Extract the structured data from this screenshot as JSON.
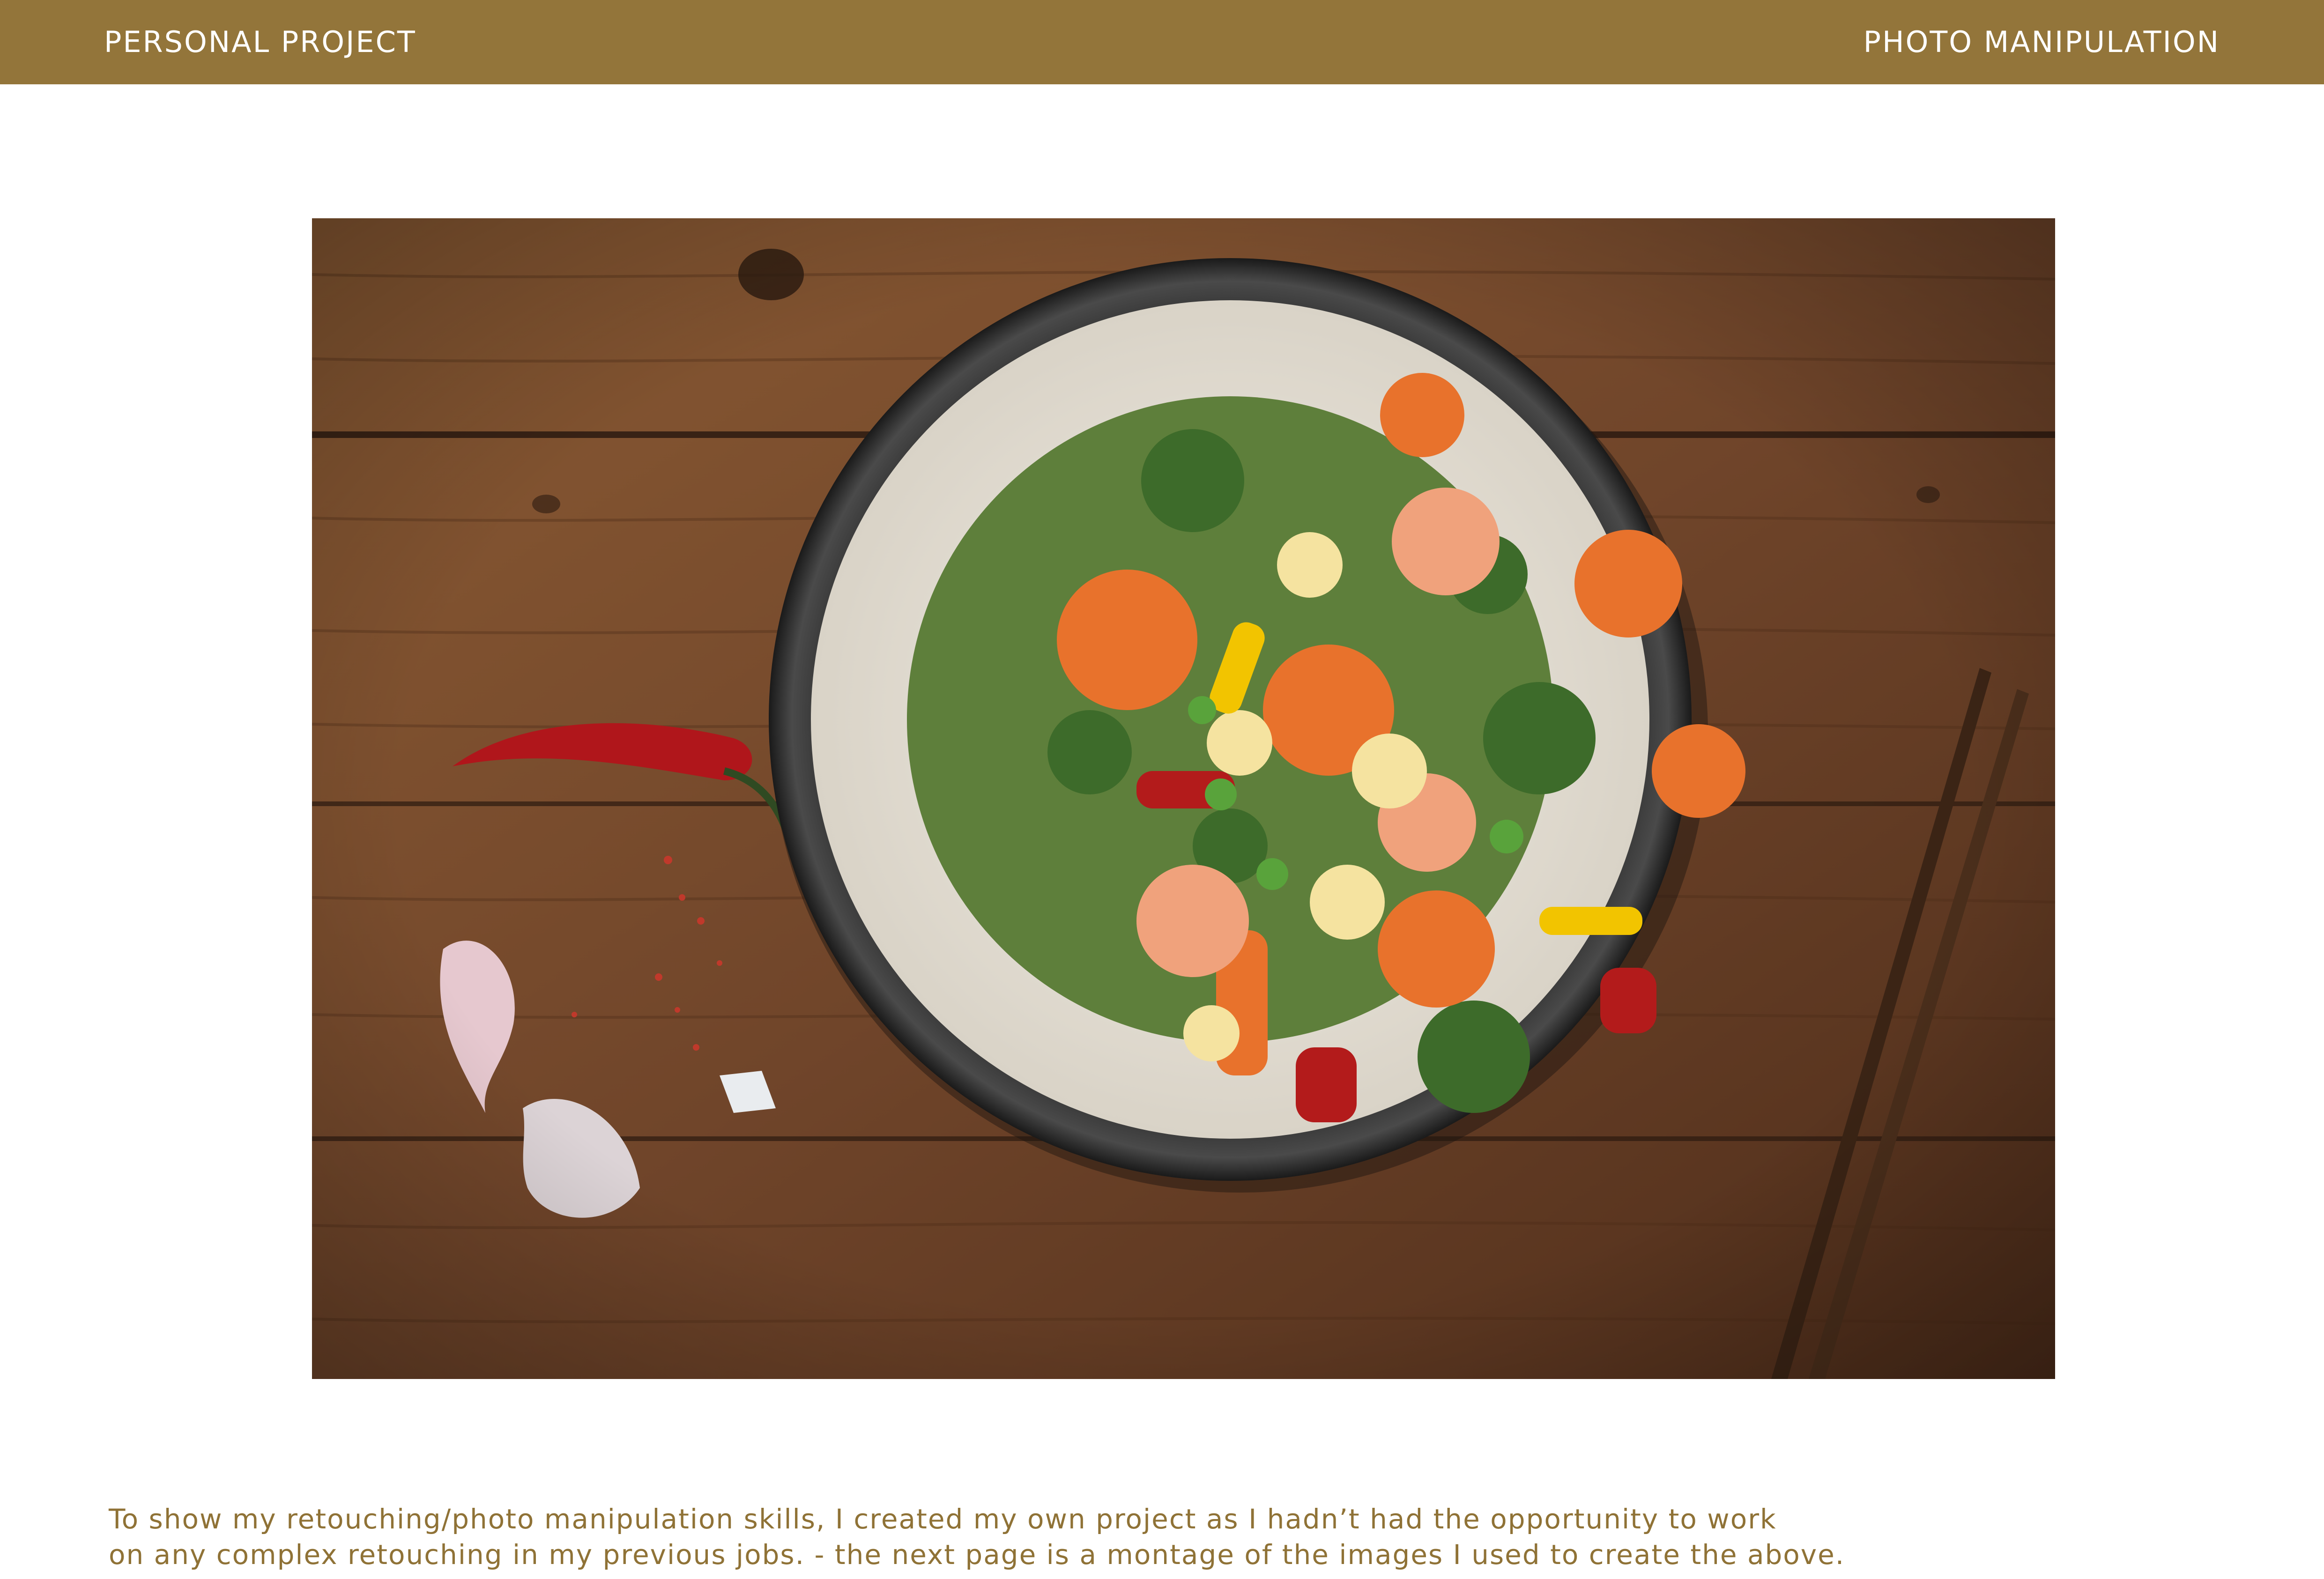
{
  "header": {
    "left_label": "PERSONAL PROJECT",
    "right_label": "PHOTO MANIPULATION"
  },
  "photo": {
    "subject": "stir-fry-rice-bowl-on-wooden-table"
  },
  "caption": {
    "line1": "To show my retouching/photo manipulation skills, I created my own project as I hadn’t had the opportunity to work",
    "line2": "on any complex retouching in my previous jobs. - the next page is a montage of the images I used to create the above."
  },
  "colors": {
    "header_bar": "#93753a",
    "caption_text": "#8f7236",
    "wood": "#6e4424"
  }
}
